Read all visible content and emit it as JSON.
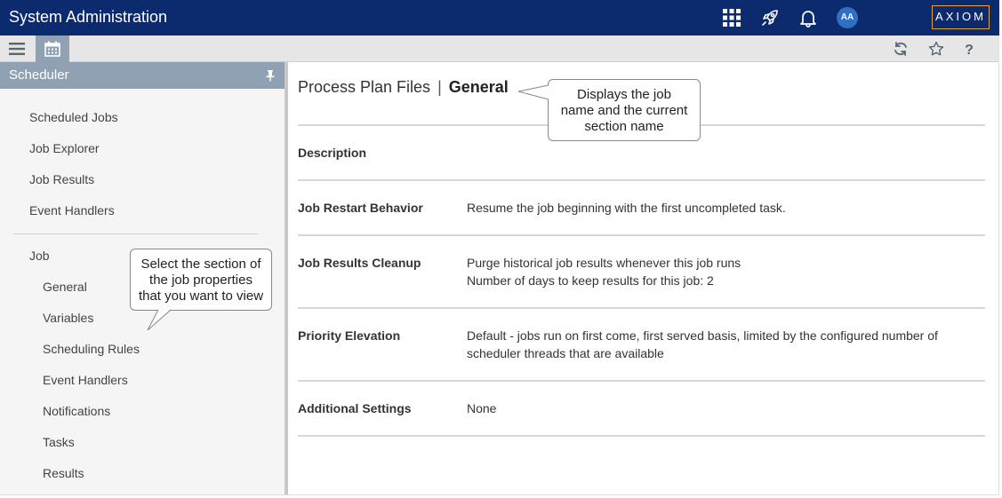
{
  "header": {
    "app_title": "System Administration",
    "logo_text": "AXIOM",
    "avatar_initials": "AA",
    "icons": [
      "apps-grid-icon",
      "rocket-icon",
      "bell-icon"
    ]
  },
  "toolbar": {
    "left_icons": [
      "hamburger-menu-icon",
      "calendar-icon"
    ],
    "right_icons": [
      "refresh-icon",
      "star-icon",
      "help-icon"
    ]
  },
  "sidebar": {
    "title": "Scheduler",
    "top_items": [
      {
        "label": "Scheduled Jobs"
      },
      {
        "label": "Job Explorer"
      },
      {
        "label": "Job Results"
      },
      {
        "label": "Event Handlers"
      }
    ],
    "job_group": {
      "label": "Job",
      "items": [
        {
          "label": "General"
        },
        {
          "label": "Variables"
        },
        {
          "label": "Scheduling Rules"
        },
        {
          "label": "Event Handlers"
        },
        {
          "label": "Notifications"
        },
        {
          "label": "Tasks"
        },
        {
          "label": "Results"
        }
      ]
    }
  },
  "callouts": {
    "sidebar": {
      "lines": [
        "Select the section of",
        "the job properties",
        "that you want to view"
      ]
    },
    "title": {
      "lines": [
        "Displays the job",
        "name and the current",
        "section name"
      ]
    }
  },
  "main": {
    "job_name": "Process Plan Files",
    "separator": "|",
    "section_name": "General",
    "rows": [
      {
        "label": "Description",
        "values": []
      },
      {
        "label": "Job Restart Behavior",
        "values": [
          "Resume the job beginning with the first uncompleted task."
        ]
      },
      {
        "label": "Job Results Cleanup",
        "values": [
          "Purge historical job results whenever this job runs",
          "Number of days to keep results for this job: 2"
        ]
      },
      {
        "label": "Priority Elevation",
        "values": [
          "Default - jobs run on first come, first served basis, limited by the configured number of scheduler threads that are available"
        ]
      },
      {
        "label": "Additional Settings",
        "values": [
          "None"
        ]
      }
    ]
  },
  "colors": {
    "header_bg": "#0c2a6e",
    "sidebar_header_bg": "#8fa1b3",
    "logo_border": "#e8a33c",
    "avatar_bg": "#2f6fc4"
  }
}
